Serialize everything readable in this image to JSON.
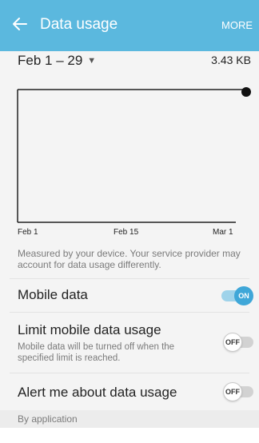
{
  "appbar": {
    "title": "Data usage",
    "more_label": "MORE",
    "back_icon": "arrow-left-icon"
  },
  "period": {
    "label": "Feb 1 – 29",
    "dropdown_icon": "triangle-down-icon",
    "total": "3.43 KB"
  },
  "chart_data": {
    "type": "line",
    "x_tick_labels": [
      "Feb 1",
      "Feb 15",
      "Mar 1"
    ]
  },
  "note": "Measured by your device. Your service provider may account for data usage differently.",
  "settings": {
    "mobile_data": {
      "label": "Mobile data",
      "toggle": "ON"
    },
    "limit": {
      "label": "Limit mobile data usage",
      "sub": "Mobile data will be turned off when the specified limit is reached.",
      "toggle": "OFF"
    },
    "alert": {
      "label": "Alert me about data usage",
      "toggle": "OFF"
    }
  },
  "section_header": "By application",
  "colors": {
    "appbar": "#5bb8de",
    "toggle_on": "#3fa7d8"
  }
}
